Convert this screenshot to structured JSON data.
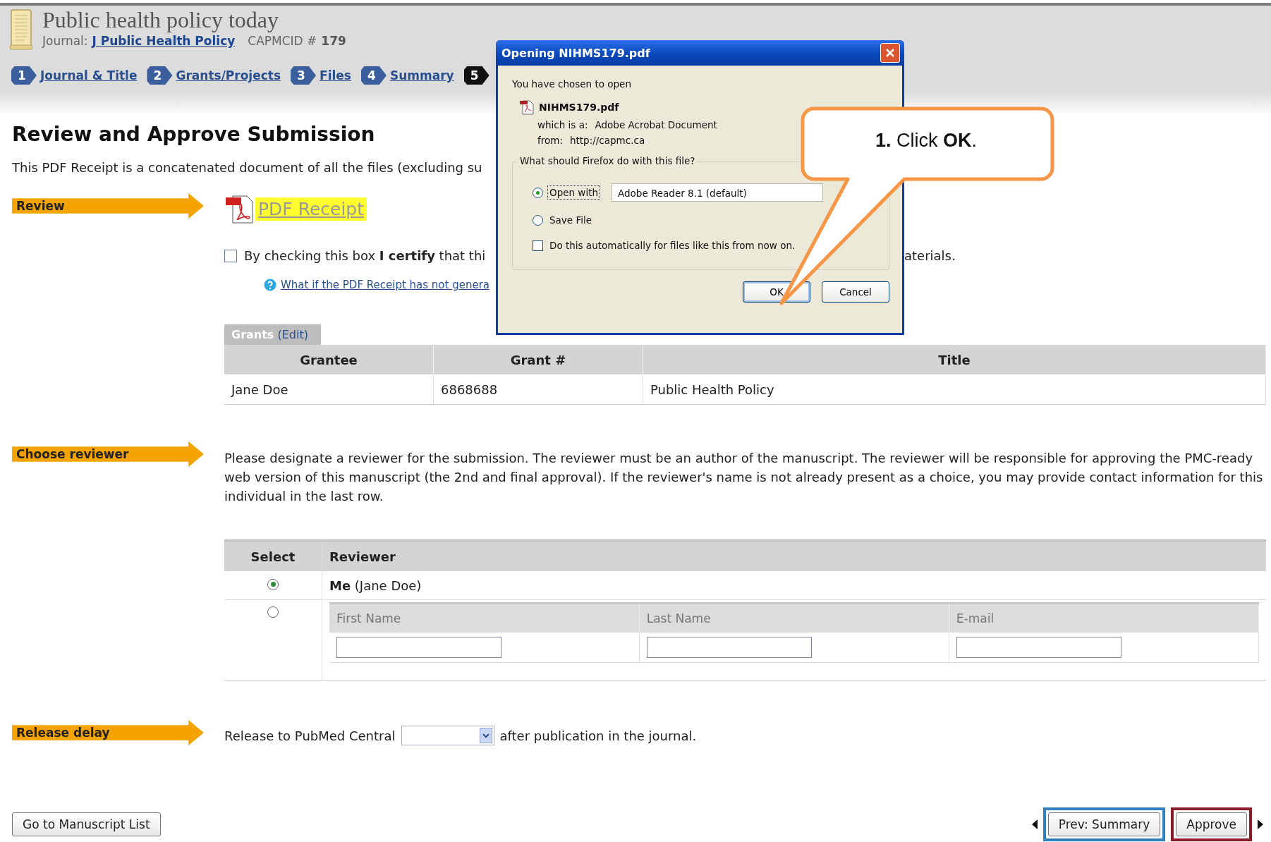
{
  "header": {
    "title": "Public health policy today",
    "journal_label": "Journal:",
    "journal": "J Public Health Policy",
    "id_label": "CAPMCID #",
    "id": "179"
  },
  "steps": [
    {
      "number": "1",
      "label": "Journal & Title",
      "selected": false
    },
    {
      "number": "2",
      "label": "Grants/Projects",
      "selected": false
    },
    {
      "number": "3",
      "label": "Files",
      "selected": false
    },
    {
      "number": "4",
      "label": "Summary",
      "selected": false
    },
    {
      "number": "5",
      "selected": true
    }
  ],
  "page_title": "Review and Approve Submission",
  "intro": "This PDF Receipt is a concatenated document of all the files (excluding su",
  "review": {
    "label": "Review",
    "receipt_link": "PDF Receipt",
    "certify_text": "By checking this box **I certify** that thi",
    "certify_checked": false,
    "certify_tail": "aterials.",
    "help_link": "What if the PDF Receipt has not genera"
  },
  "grants": {
    "tab": "Grants",
    "edit": "(Edit)",
    "columns": [
      "Grantee",
      "Grant #",
      "Title"
    ],
    "rows": [
      [
        "Jane Doe",
        "6868688",
        "Public Health Policy"
      ]
    ]
  },
  "choose_reviewer": {
    "label": "Choose reviewer",
    "paragraph": "Please designate a reviewer for the submission. The reviewer must be an author of the manuscript. The reviewer will be responsible for approving the PMC-ready web version of this manuscript (the 2nd and final approval). If the reviewer's name is not already present as a choice, you may provide contact information for this individual in the last row.",
    "columns": [
      "Select",
      "Reviewer"
    ],
    "options": [
      {
        "kind": "self",
        "selected": true,
        "name": "**Me** (Jane Doe)"
      },
      {
        "kind": "other",
        "selected": false,
        "fields": [
          {
            "label": "First Name"
          },
          {
            "label": "Last Name"
          },
          {
            "label": "E-mail"
          }
        ]
      }
    ]
  },
  "release": {
    "label": "Release delay",
    "before": "Release to PubMed Central",
    "after": "after publication in the journal."
  },
  "manuscript_button": "Go to Manuscript List",
  "nav_buttons": [
    {
      "label": "Prev: Summary",
      "color": "#2f7fc1"
    },
    {
      "label": "Approve",
      "color": "#8c1c2c"
    }
  ],
  "dialog": {
    "title": "Opening NIHMS179.pdf",
    "intro": "You have chosen to open",
    "filename": "NIHMS179.pdf",
    "type_label": "which is a:",
    "type": "Adobe Acrobat Document",
    "from_label": "from:",
    "from": "http://capmc.ca",
    "question": "What should Firefox do with this file?",
    "options": [
      {
        "kind": "radio",
        "label": "Open with",
        "selected": true,
        "app": "Adobe Reader 8.1 (default)"
      },
      {
        "kind": "radio",
        "label": "Save File",
        "selected": false
      },
      {
        "kind": "checkbox",
        "label": "Do this automatically for files like this from now on.",
        "checked": false
      }
    ],
    "buttons": [
      {
        "label": "OK",
        "default": true
      },
      {
        "label": "Cancel",
        "default": false
      }
    ]
  },
  "callout": {
    "text": "**1.** Click **OK**."
  }
}
